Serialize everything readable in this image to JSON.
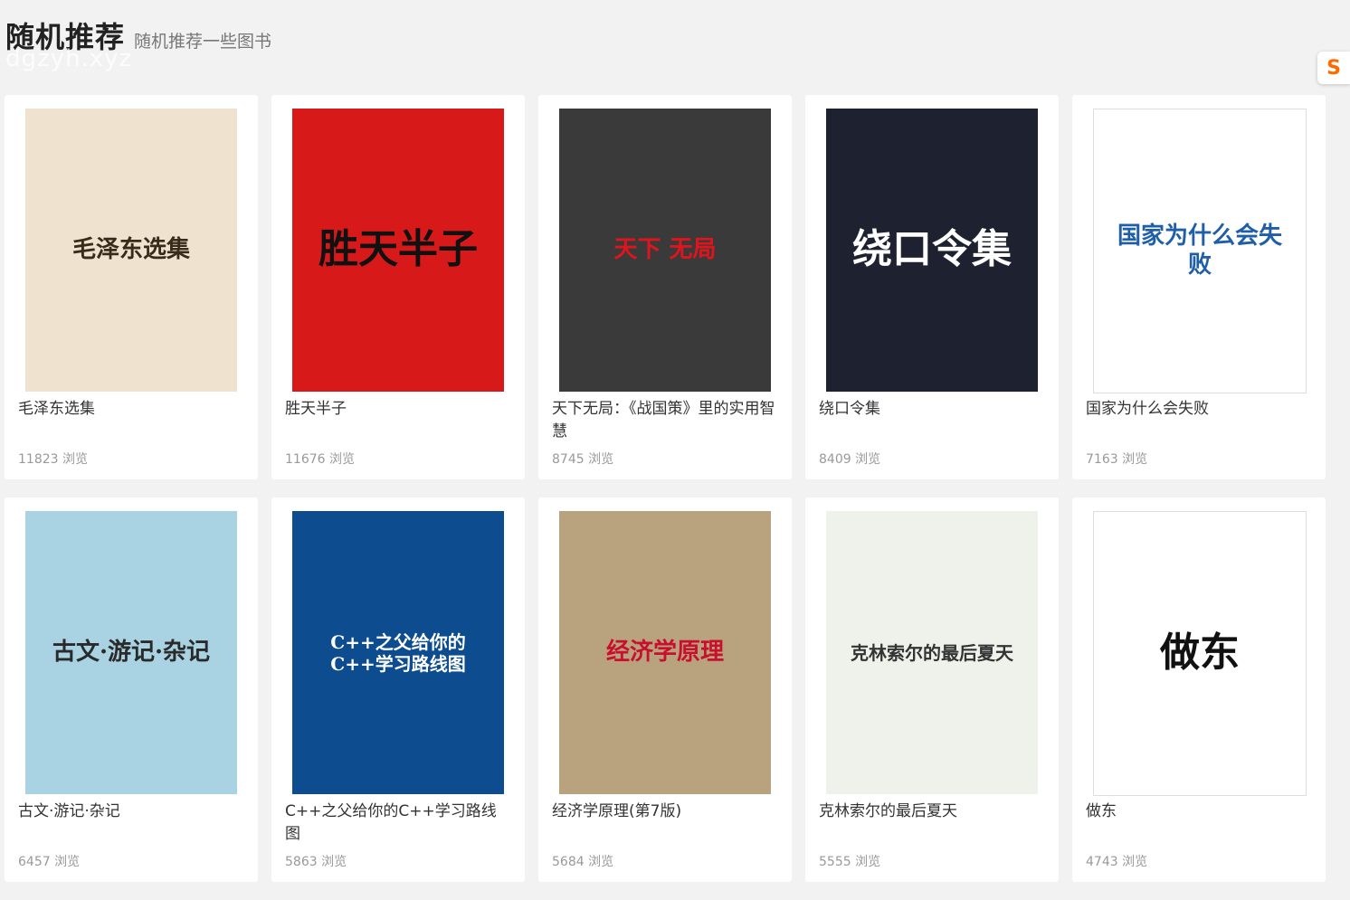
{
  "header": {
    "title": "随机推荐",
    "subtitle": "随机推荐一些图书",
    "watermark": "dgzyh.xyz"
  },
  "side_logo": {
    "icon": "sogou-s-icon",
    "glyph": "S",
    "color": "#ff6a00"
  },
  "books": [
    {
      "title": "毛泽东选集",
      "views": "11823 浏览",
      "cover_text": "毛泽东选集",
      "cover_bg": "#efe2cf",
      "cover_fg": "#3a2a1a"
    },
    {
      "title": "胜天半子",
      "views": "11676 浏览",
      "cover_text": "胜天半子",
      "cover_bg": "#d8191a",
      "cover_fg": "#111111"
    },
    {
      "title": "天下无局：《战国策》里的实用智慧",
      "views": "8745 浏览",
      "cover_text": "天下 无局",
      "cover_bg": "#3a3a3a",
      "cover_fg": "#e0141c"
    },
    {
      "title": "绕口令集",
      "views": "8409 浏览",
      "cover_text": "绕口令集",
      "cover_bg": "#1e2230",
      "cover_fg": "#ffffff"
    },
    {
      "title": "国家为什么会失败",
      "views": "7163 浏览",
      "cover_text": "国家为什么会失败",
      "cover_bg": "#ffffff",
      "cover_fg": "#1f5fa8"
    },
    {
      "title": "古文·游记·杂记",
      "views": "6457 浏览",
      "cover_text": "古文·游记·杂记",
      "cover_bg": "#a9d2e3",
      "cover_fg": "#2a2a2a"
    },
    {
      "title": "C++之父给你的C++学习路线图",
      "views": "5863 浏览",
      "cover_text": "C++之父给你的C++学习路线图",
      "cover_bg": "#0d4c8f",
      "cover_fg": "#ffffff"
    },
    {
      "title": "经济学原理(第7版)",
      "views": "5684 浏览",
      "cover_text": "经济学原理",
      "cover_bg": "#b9a27e",
      "cover_fg": "#c8102e"
    },
    {
      "title": "克林索尔的最后夏天",
      "views": "5555 浏览",
      "cover_text": "克林索尔的最后夏天",
      "cover_bg": "#eef2ea",
      "cover_fg": "#333333"
    },
    {
      "title": "做东",
      "views": "4743 浏览",
      "cover_text": "做东",
      "cover_bg": "#ffffff",
      "cover_fg": "#111111"
    }
  ]
}
